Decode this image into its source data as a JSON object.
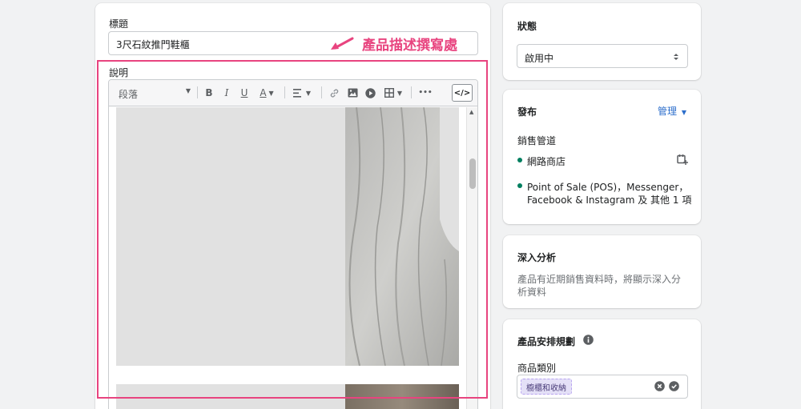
{
  "title_field": {
    "label": "標題",
    "value": "3尺石紋推門鞋櫃"
  },
  "annotation": {
    "text": "產品描述撰寫處",
    "color": "#e8447f"
  },
  "description": {
    "label": "說明",
    "toolbar": {
      "paragraph": "段落",
      "bold": "B",
      "italic": "I",
      "underline": "U",
      "text_color": "A",
      "more": "•••",
      "code": "</>"
    }
  },
  "status": {
    "heading": "狀態",
    "selected": "啟用中"
  },
  "publishing": {
    "heading": "發布",
    "manage": "管理",
    "channels_label": "銷售管道",
    "channels": [
      {
        "name": "網路商店"
      },
      {
        "name_line1": "Point of Sale (POS)，Messenger，",
        "name_line2": "Facebook & Instagram 及 其他 1 項"
      }
    ]
  },
  "insights": {
    "heading": "深入分析",
    "text_line1": "產品有近期銷售資料時，將顯示深入分",
    "text_line2": "析資料"
  },
  "organization": {
    "heading": "產品安排規劃",
    "type_label": "商品類別",
    "tag": "櫥櫃和收納"
  },
  "colors": {
    "accent": "#2c6ecb",
    "green": "#007f5f",
    "annotation": "#e8447f",
    "tag_bg": "#e4e0f7",
    "tag_border": "#b9a5f0"
  }
}
